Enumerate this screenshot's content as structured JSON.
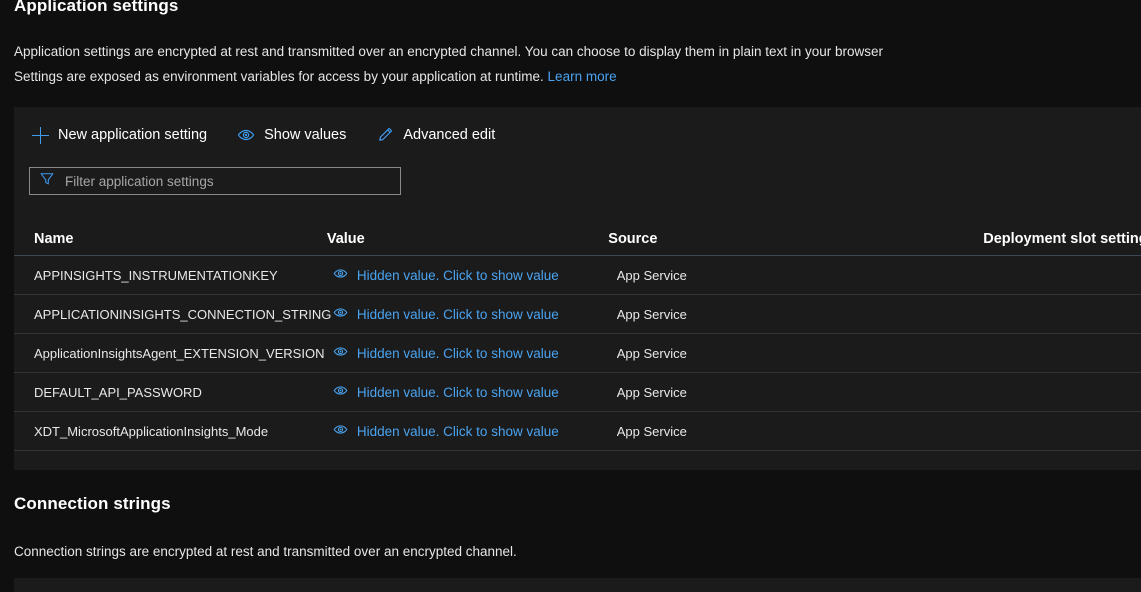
{
  "app_settings": {
    "title": "Application settings",
    "description_line1": "Application settings are encrypted at rest and transmitted over an encrypted channel. You can choose to display them in plain text in your browser",
    "description_line2": "Settings are exposed as environment variables for access by your application at runtime.",
    "learn_more": "Learn more",
    "toolbar": {
      "new_setting": "New application setting",
      "show_values": "Show values",
      "advanced_edit": "Advanced edit"
    },
    "filter": {
      "placeholder": "Filter application settings",
      "value": ""
    },
    "table": {
      "headers": {
        "name": "Name",
        "value": "Value",
        "source": "Source",
        "slot": "Deployment slot setting"
      },
      "rows": [
        {
          "name": "APPINSIGHTS_INSTRUMENTATIONKEY",
          "value": "Hidden value. Click to show value",
          "source": "App Service",
          "slot": ""
        },
        {
          "name": "APPLICATIONINSIGHTS_CONNECTION_STRING",
          "value": "Hidden value. Click to show value",
          "source": "App Service",
          "slot": ""
        },
        {
          "name": "ApplicationInsightsAgent_EXTENSION_VERSION",
          "value": "Hidden value. Click to show value",
          "source": "App Service",
          "slot": ""
        },
        {
          "name": "DEFAULT_API_PASSWORD",
          "value": "Hidden value. Click to show value",
          "source": "App Service",
          "slot": ""
        },
        {
          "name": "XDT_MicrosoftApplicationInsights_Mode",
          "value": "Hidden value. Click to show value",
          "source": "App Service",
          "slot": ""
        }
      ]
    }
  },
  "connection_strings": {
    "title": "Connection strings",
    "description": "Connection strings are encrypted at rest and transmitted over an encrypted channel."
  },
  "colors": {
    "page_background": "#0f0f0f",
    "panel_background": "#1b1b1b",
    "accent_blue": "#4aa3f0",
    "icon_blue": "#3d9bf0",
    "text_primary": "#ffffff",
    "row_divider": "#333333",
    "header_divider": "#3b4754",
    "placeholder_text": "#a6a6a6",
    "input_border": "#8a8886"
  },
  "icons": {
    "plus": "plus-icon",
    "eye": "eye-icon",
    "pencil": "pencil-icon",
    "funnel": "funnel-icon"
  }
}
